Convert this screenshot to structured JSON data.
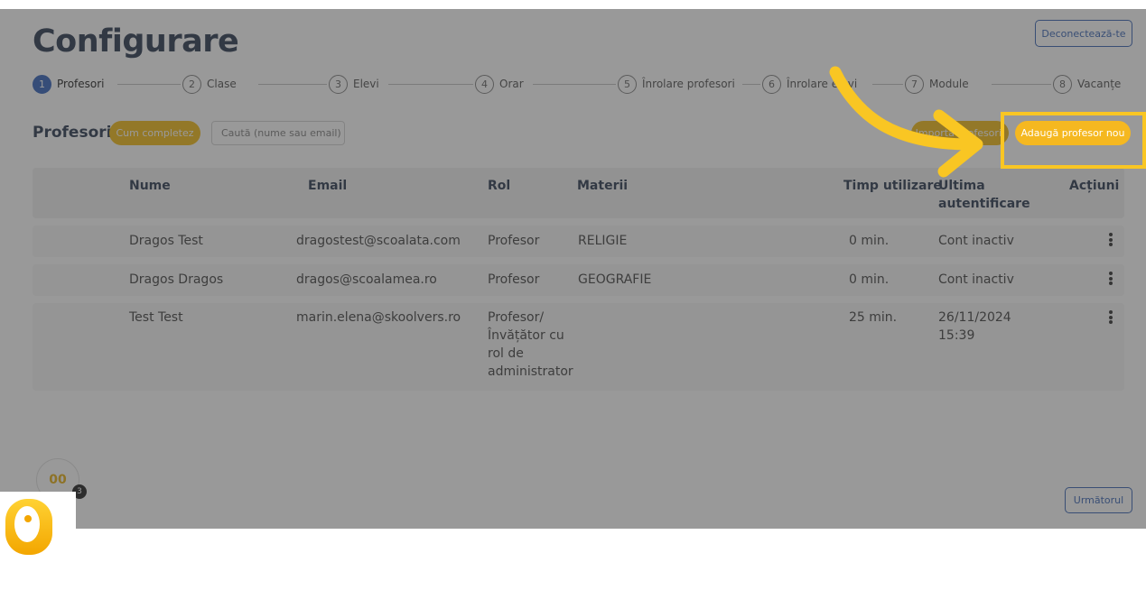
{
  "page": {
    "title": "Configurare",
    "logout_label": "Deconectează-te",
    "next_label": "Următorul"
  },
  "steps": [
    {
      "num": "1",
      "label": "Profesori",
      "active": true
    },
    {
      "num": "2",
      "label": "Clase"
    },
    {
      "num": "3",
      "label": "Elevi"
    },
    {
      "num": "4",
      "label": "Orar"
    },
    {
      "num": "5",
      "label": "Înrolare profesori"
    },
    {
      "num": "6",
      "label": "Înrolare elevi"
    },
    {
      "num": "7",
      "label": "Module"
    },
    {
      "num": "8",
      "label": "Vacanțe"
    }
  ],
  "section": {
    "title": "Profesori",
    "how_label": "Cum completez",
    "search_placeholder": "Caută (nume sau email)",
    "import_label": "Importă profesori",
    "add_label": "Adaugă profesor nou"
  },
  "table": {
    "headers": {
      "name": "Nume",
      "email": "Email",
      "role": "Rol",
      "subjects": "Materii",
      "time": "Timp utilizare",
      "last_login": "Ultima autentificare",
      "actions": "Acțiuni"
    },
    "rows": [
      {
        "name": "Dragos Test",
        "email": "dragostest@scoalata.com",
        "role": "Profesor",
        "subjects": "RELIGIE",
        "time": "0 min.",
        "last_login": "Cont inactiv"
      },
      {
        "name": "Dragos Dragos",
        "email": "dragos@scoalamea.ro",
        "role": "Profesor",
        "subjects": "GEOGRAFIE",
        "time": "0 min.",
        "last_login": "Cont inactiv"
      },
      {
        "name": "Test Test",
        "email": "marin.elena@skoolvers.ro",
        "role": "Profesor/ Învățător cu rol de administrator",
        "subjects": "",
        "time": "25 min.",
        "last_login": "26/11/2024 15:39"
      }
    ]
  },
  "chat": {
    "badge_count": "3",
    "avatar_text": "00"
  },
  "colors": {
    "accent_yellow": "#f5b820",
    "primary_blue": "#2457b5",
    "highlight": "#f9c623"
  },
  "icons": [
    "kebab-menu-icon",
    "arrow-annotation-icon",
    "brand-logo-icon"
  ]
}
